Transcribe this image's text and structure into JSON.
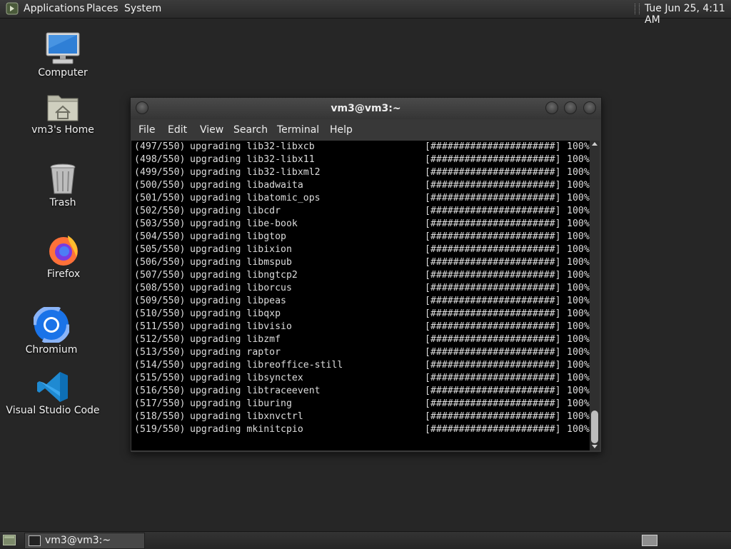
{
  "top_panel": {
    "menus": [
      "Applications",
      "Places",
      "System"
    ],
    "clock": "Tue Jun 25,  4:11 AM"
  },
  "desktop_icons": [
    {
      "label": "Computer",
      "icon": "computer-icon"
    },
    {
      "label": "vm3's Home",
      "icon": "home-folder-icon"
    },
    {
      "label": "Trash",
      "icon": "trash-icon"
    },
    {
      "label": "Firefox",
      "icon": "firefox-icon"
    },
    {
      "label": "Chromium",
      "icon": "chromium-icon"
    },
    {
      "label": "Visual Studio Code",
      "icon": "vscode-icon"
    }
  ],
  "terminal": {
    "title": "vm3@vm3:~",
    "menu": [
      "File",
      "Edit",
      "View",
      "Search",
      "Terminal",
      "Help"
    ],
    "lines": [
      {
        "index": "(497/550)",
        "action": "upgrading lib32-libxcb",
        "bar": "[######################]",
        "percent": "100%"
      },
      {
        "index": "(498/550)",
        "action": "upgrading lib32-libx11",
        "bar": "[######################]",
        "percent": "100%"
      },
      {
        "index": "(499/550)",
        "action": "upgrading lib32-libxml2",
        "bar": "[######################]",
        "percent": "100%"
      },
      {
        "index": "(500/550)",
        "action": "upgrading libadwaita",
        "bar": "[######################]",
        "percent": "100%"
      },
      {
        "index": "(501/550)",
        "action": "upgrading libatomic_ops",
        "bar": "[######################]",
        "percent": "100%"
      },
      {
        "index": "(502/550)",
        "action": "upgrading libcdr",
        "bar": "[######################]",
        "percent": "100%"
      },
      {
        "index": "(503/550)",
        "action": "upgrading libe-book",
        "bar": "[######################]",
        "percent": "100%"
      },
      {
        "index": "(504/550)",
        "action": "upgrading libgtop",
        "bar": "[######################]",
        "percent": "100%"
      },
      {
        "index": "(505/550)",
        "action": "upgrading libixion",
        "bar": "[######################]",
        "percent": "100%"
      },
      {
        "index": "(506/550)",
        "action": "upgrading libmspub",
        "bar": "[######################]",
        "percent": "100%"
      },
      {
        "index": "(507/550)",
        "action": "upgrading libngtcp2",
        "bar": "[######################]",
        "percent": "100%"
      },
      {
        "index": "(508/550)",
        "action": "upgrading liborcus",
        "bar": "[######################]",
        "percent": "100%"
      },
      {
        "index": "(509/550)",
        "action": "upgrading libpeas",
        "bar": "[######################]",
        "percent": "100%"
      },
      {
        "index": "(510/550)",
        "action": "upgrading libqxp",
        "bar": "[######################]",
        "percent": "100%"
      },
      {
        "index": "(511/550)",
        "action": "upgrading libvisio",
        "bar": "[######################]",
        "percent": "100%"
      },
      {
        "index": "(512/550)",
        "action": "upgrading libzmf",
        "bar": "[######################]",
        "percent": "100%"
      },
      {
        "index": "(513/550)",
        "action": "upgrading raptor",
        "bar": "[######################]",
        "percent": "100%"
      },
      {
        "index": "(514/550)",
        "action": "upgrading libreoffice-still",
        "bar": "[######################]",
        "percent": "100%"
      },
      {
        "index": "(515/550)",
        "action": "upgrading libsynctex",
        "bar": "[######################]",
        "percent": "100%"
      },
      {
        "index": "(516/550)",
        "action": "upgrading libtraceevent",
        "bar": "[######################]",
        "percent": "100%"
      },
      {
        "index": "(517/550)",
        "action": "upgrading liburing",
        "bar": "[######################]",
        "percent": "100%"
      },
      {
        "index": "(518/550)",
        "action": "upgrading libxnvctrl",
        "bar": "[######################]",
        "percent": "100%"
      },
      {
        "index": "(519/550)",
        "action": "upgrading mkinitcpio",
        "bar": "[######################]",
        "percent": "100%"
      }
    ]
  },
  "taskbar": {
    "window_label": "vm3@vm3:~"
  }
}
